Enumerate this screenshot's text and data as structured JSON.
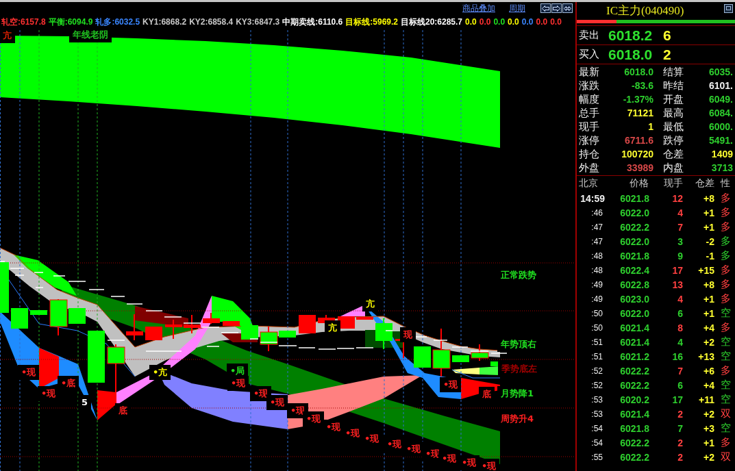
{
  "toolbar": {
    "links": [
      "商品叠加",
      "周期"
    ]
  },
  "indicators": [
    {
      "text": "轧空:6157.8",
      "color": "#ff3030"
    },
    {
      "text": "平衡:6094.9",
      "color": "#20e020"
    },
    {
      "text": "轧多:6032.5",
      "color": "#3a86ff"
    },
    {
      "text": "KY1:6868.2",
      "color": "#c8c8c8"
    },
    {
      "text": "KY2:6858.4",
      "color": "#c8c8c8"
    },
    {
      "text": "KY3:6847.3",
      "color": "#c8c8c8"
    },
    {
      "text": "中期卖线:6110.6",
      "color": "#ffffff"
    },
    {
      "text": "目标线:5969.2",
      "color": "#ffff00"
    },
    {
      "text": "目标线20:6285.7",
      "color": "#ffffff"
    },
    {
      "text": "0.0",
      "color": "#ffff00"
    },
    {
      "text": "0.0",
      "color": "#ff3030"
    },
    {
      "text": "0.0",
      "color": "#20e020"
    },
    {
      "text": "0.0",
      "color": "#ffff00"
    },
    {
      "text": "0.0",
      "color": "#3a86ff"
    },
    {
      "text": "0.0",
      "color": "#ff3030"
    },
    {
      "text": "0.0",
      "color": "#ff3030"
    }
  ],
  "chart_labels": [
    {
      "text": "亢",
      "color": "#e02000"
    },
    {
      "text": "年线老阴",
      "color": "#20c020"
    },
    {
      "text": "正常跌势",
      "color": "#20e020"
    },
    {
      "text": "亢",
      "color": "#ffff00"
    },
    {
      "text": "亢",
      "color": "#ffff00"
    },
    {
      "text": "现",
      "color": "#ff2020"
    },
    {
      "text": "年势顶右",
      "color": "#20e020"
    },
    {
      "text": "•现",
      "color": "#ff2020"
    },
    {
      "text": "•亢",
      "color": "#ffff00"
    },
    {
      "text": "•局",
      "color": "#20e020"
    },
    {
      "text": "季势底左",
      "color": "#a00000"
    },
    {
      "text": "•底",
      "color": "#ff2020"
    },
    {
      "text": "•现",
      "color": "#ff2020"
    },
    {
      "text": "•现",
      "color": "#ff2020"
    },
    {
      "text": "•现",
      "color": "#ff2020"
    },
    {
      "text": "•现",
      "color": "#ff2020"
    },
    {
      "text": "底",
      "color": "#ff2020"
    },
    {
      "text": "月势降1",
      "color": "#20e020"
    },
    {
      "text": "5",
      "color": "#ffffff"
    },
    {
      "text": "•现",
      "color": "#ff2020"
    },
    {
      "text": "底",
      "color": "#ff2020"
    },
    {
      "text": "•现",
      "color": "#ff2020"
    },
    {
      "text": "•现",
      "color": "#ff2020"
    },
    {
      "text": "周势升4",
      "color": "#ff2020"
    },
    {
      "text": "•现",
      "color": "#ff2020"
    },
    {
      "text": "•现",
      "color": "#ff2020"
    },
    {
      "text": "•现",
      "color": "#ff2020"
    },
    {
      "text": "•现",
      "color": "#ff2020"
    },
    {
      "text": "•现",
      "color": "#ff2020"
    },
    {
      "text": "•现",
      "color": "#ff2020"
    },
    {
      "text": "•现",
      "color": "#ff2020"
    },
    {
      "text": "•现",
      "color": "#ff2020"
    },
    {
      "text": "•现",
      "color": "#ff2020"
    }
  ],
  "quote_panel": {
    "title": "IC主力(040490)",
    "ratio_bar": {
      "level": 0.25
    },
    "orders": [
      {
        "label": "卖出",
        "price": "6018.2",
        "volume": "6"
      },
      {
        "label": "买入",
        "price": "6018.0",
        "volume": "2"
      }
    ],
    "stats": [
      {
        "cells": [
          {
            "label": "最新",
            "value": "6018.0",
            "color": "#2ecf2e"
          },
          {
            "label": "结算",
            "value": "6035.",
            "color": "#2ecf2e"
          }
        ]
      },
      {
        "cells": [
          {
            "label": "涨跌",
            "value": "-83.6",
            "color": "#2ecf2e"
          },
          {
            "label": "昨结",
            "value": "6101.",
            "color": "#f0f0f0"
          }
        ]
      },
      {
        "cells": [
          {
            "label": "幅度",
            "value": "-1.37%",
            "color": "#2ecf2e"
          },
          {
            "label": "开盘",
            "value": "6049.",
            "color": "#2ecf2e"
          }
        ]
      },
      {
        "cells": [
          {
            "label": "总手",
            "value": "71121",
            "color": "#ffff30"
          },
          {
            "label": "最高",
            "value": "6084.",
            "color": "#2ecf2e"
          }
        ]
      },
      {
        "cells": [
          {
            "label": "现手",
            "value": "1",
            "color": "#ffff30"
          },
          {
            "label": "最低",
            "value": "6000.",
            "color": "#2ecf2e"
          }
        ]
      },
      {
        "cells": [
          {
            "label": "涨停",
            "value": "6711.6",
            "color": "#d84848"
          },
          {
            "label": "跌停",
            "value": "5491.",
            "color": "#2ecf2e"
          }
        ]
      },
      {
        "cells": [
          {
            "label": "持仓",
            "value": "100720",
            "color": "#ffff30"
          },
          {
            "label": "仓差",
            "value": "1409",
            "color": "#ffff30"
          }
        ]
      },
      {
        "cells": [
          {
            "label": "外盘",
            "value": "33989",
            "color": "#d84848"
          },
          {
            "label": "内盘",
            "value": "3713",
            "color": "#2ecf2e"
          }
        ]
      }
    ]
  },
  "ticks": {
    "columns": [
      "北京",
      "价格",
      "现手",
      "仓差",
      "性"
    ],
    "rows": [
      {
        "time": "14:59",
        "price": "6021.8",
        "volume": "12",
        "oi_change": "+8",
        "nature": "多",
        "color": "#ff4040"
      },
      {
        "time": ":46",
        "price": "6022.0",
        "volume": "4",
        "oi_change": "+1",
        "nature": "多",
        "color": "#ff4040"
      },
      {
        "time": ":47",
        "price": "6022.2",
        "volume": "7",
        "oi_change": "+1",
        "nature": "多",
        "color": "#ff4040"
      },
      {
        "time": ":47",
        "price": "6022.0",
        "volume": "3",
        "oi_change": "-2",
        "nature": "多",
        "color": "#2ecf2e"
      },
      {
        "time": ":48",
        "price": "6021.8",
        "volume": "9",
        "oi_change": "-1",
        "nature": "多",
        "color": "#2ecf2e"
      },
      {
        "time": ":48",
        "price": "6022.4",
        "volume": "17",
        "oi_change": "+15",
        "nature": "多",
        "color": "#ff4040"
      },
      {
        "time": ":49",
        "price": "6022.8",
        "volume": "13",
        "oi_change": "+8",
        "nature": "多",
        "color": "#ff4040"
      },
      {
        "time": ":49",
        "price": "6023.0",
        "volume": "4",
        "oi_change": "+1",
        "nature": "多",
        "color": "#ff4040"
      },
      {
        "time": ":50",
        "price": "6022.0",
        "volume": "6",
        "oi_change": "+1",
        "nature": "空",
        "color": "#2ecf2e"
      },
      {
        "time": ":50",
        "price": "6021.4",
        "volume": "8",
        "oi_change": "+4",
        "nature": "多",
        "color": "#ff4040"
      },
      {
        "time": ":51",
        "price": "6021.4",
        "volume": "4",
        "oi_change": "+2",
        "nature": "空",
        "color": "#2ecf2e"
      },
      {
        "time": ":51",
        "price": "6021.2",
        "volume": "16",
        "oi_change": "+13",
        "nature": "空",
        "color": "#2ecf2e"
      },
      {
        "time": ":52",
        "price": "6022.2",
        "volume": "7",
        "oi_change": "+6",
        "nature": "多",
        "color": "#ff4040"
      },
      {
        "time": ":52",
        "price": "6022.2",
        "volume": "6",
        "oi_change": "+4",
        "nature": "空",
        "color": "#2ecf2e"
      },
      {
        "time": ":53",
        "price": "6020.2",
        "volume": "17",
        "oi_change": "+11",
        "nature": "空",
        "color": "#2ecf2e"
      },
      {
        "time": ":53",
        "price": "6021.4",
        "volume": "2",
        "oi_change": "+2",
        "nature": "双",
        "color": "#ff4040"
      },
      {
        "time": ":54",
        "price": "6021.8",
        "volume": "7",
        "oi_change": "+3",
        "nature": "空",
        "color": "#2ecf2e"
      },
      {
        "time": ":54",
        "price": "6022.2",
        "volume": "2",
        "oi_change": "+1",
        "nature": "多",
        "color": "#ff4040"
      },
      {
        "time": ":55",
        "price": "6022.2",
        "volume": "2",
        "oi_change": "+2",
        "nature": "双",
        "color": "#ff4040"
      }
    ]
  }
}
